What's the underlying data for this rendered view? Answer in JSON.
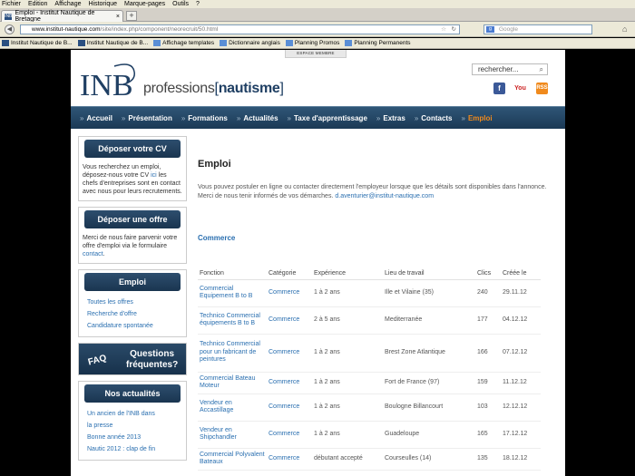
{
  "browser": {
    "menu": [
      "Fichier",
      "Edition",
      "Affichage",
      "Historique",
      "Marque-pages",
      "Outils",
      "?"
    ],
    "tab_title": "Emploi - Institut Nautique de Bretagne",
    "favicon_text": "INB",
    "newtab": "+",
    "url_host": "www.institut-nautique.com",
    "url_path": "/site/index.php/component/neorecruit/50.html",
    "search_placeholder": "Google",
    "bookmarks": [
      "Institut Nautique de B...",
      "Institut Nautique de B...",
      "Affichage templates",
      "Dictionnaire anglais",
      "Planning Promos",
      "Planning Permanents"
    ]
  },
  "header": {
    "espace_membre": "ESPACE MEMBRE",
    "logo_letters": "INB",
    "logo_word": "professions",
    "logo_bracket_open": "[",
    "logo_bold": "nautisme",
    "logo_bracket_close": "]",
    "search_placeholder": "rechercher...",
    "social": {
      "facebook": "f",
      "youtube": "You",
      "rss": "RSS"
    }
  },
  "nav": [
    {
      "label": "Accueil",
      "active": false
    },
    {
      "label": "Présentation",
      "active": false
    },
    {
      "label": "Formations",
      "active": false
    },
    {
      "label": "Actualités",
      "active": false
    },
    {
      "label": "Taxe d'apprentissage",
      "active": false
    },
    {
      "label": "Extras",
      "active": false
    },
    {
      "label": "Contacts",
      "active": false
    },
    {
      "label": "Emploi",
      "active": true
    }
  ],
  "sidebar": {
    "cv": {
      "title": "Déposer votre CV",
      "text_a": "Vous recherchez un emploi, déposez-nous votre CV ",
      "link": "ici",
      "text_b": " les chefs d'entreprises sont en contact avec nous pour leurs recrutements."
    },
    "offre": {
      "title": "Déposer une offre",
      "text_a": "Merci de nous faire parvenir votre offre d'emploi via le formulaire ",
      "link": "contact",
      "text_b": "."
    },
    "emploi": {
      "title": "Emploi",
      "items": [
        "Toutes les offres",
        "Recherche d'offre",
        "Candidature spontanée"
      ]
    },
    "faq": {
      "word": "FAQ",
      "line1": "Questions",
      "line2": "fréquentes?"
    },
    "actualites": {
      "title": "Nos actualités",
      "items": [
        "Un ancien de l'INB dans",
        "la presse",
        "Bonne année 2013",
        "Nautic 2012 : clap de fin"
      ]
    }
  },
  "main": {
    "title": "Emploi",
    "intro": "Vous pouvez postuler en ligne ou contacter directement l'employeur lorsque que les détails sont disponibles dans l'annonce. Merci de nous tenir informés de vos démarches. ",
    "email": "d.aventurier@institut-nautique.com",
    "category": "Commerce",
    "columns": [
      "Fonction",
      "Catégorie",
      "Expérience",
      "Lieu de travail",
      "Clics",
      "Créée le"
    ],
    "rows": [
      [
        "Commercial Equipement B to B",
        "Commerce",
        "1 à 2 ans",
        "Ille et Vilaine (35)",
        "240",
        "29.11.12"
      ],
      [
        "Technico Commercial équipements B to B",
        "Commerce",
        "2 à 5 ans",
        "Mediterranée",
        "177",
        "04.12.12"
      ],
      [
        "Technico Commercial pour un fabricant de peintures",
        "Commerce",
        "1 à 2 ans",
        "Brest Zone Atlantique",
        "166",
        "07.12.12"
      ],
      [
        "Commercial Bateau Moteur",
        "Commerce",
        "1 à 2 ans",
        "Fort de France (97)",
        "159",
        "11.12.12"
      ],
      [
        "Vendeur en Accastillage",
        "Commerce",
        "1 à 2 ans",
        "Boulogne Billancourt",
        "103",
        "12.12.12"
      ],
      [
        "Vendeur en Shipchandler",
        "Commerce",
        "1 à 2 ans",
        "Guadeloupe",
        "165",
        "17.12.12"
      ],
      [
        "Commercial Polyvalent Bateaux",
        "Commerce",
        "débutant accepté",
        "Courseulles (14)",
        "135",
        "18.12.12"
      ]
    ]
  }
}
